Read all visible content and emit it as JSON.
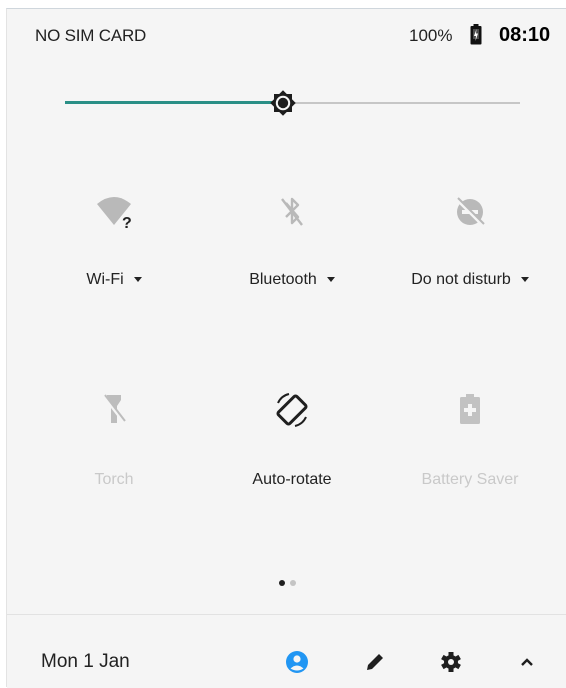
{
  "status": {
    "carrier": "NO SIM CARD",
    "battery_percent": "100%",
    "time": "08:10",
    "icons": [
      "battery-icon"
    ]
  },
  "brightness": {
    "level": 0.48,
    "accent": "#2a8f86"
  },
  "tiles": [
    {
      "id": "wifi",
      "label": "Wi-Fi",
      "icon": "wifi-unknown-icon",
      "expandable": true,
      "enabled": true
    },
    {
      "id": "bluetooth",
      "label": "Bluetooth",
      "icon": "bluetooth-off-icon",
      "expandable": true,
      "enabled": true
    },
    {
      "id": "dnd",
      "label": "Do not disturb",
      "icon": "do-not-disturb-off-icon",
      "expandable": true,
      "enabled": true
    },
    {
      "id": "torch",
      "label": "Torch",
      "icon": "torch-icon",
      "expandable": false,
      "enabled": false
    },
    {
      "id": "rotate",
      "label": "Auto-rotate",
      "icon": "auto-rotate-icon",
      "expandable": false,
      "enabled": true
    },
    {
      "id": "battery_saver",
      "label": "Battery Saver",
      "icon": "battery-saver-icon",
      "expandable": false,
      "enabled": false
    }
  ],
  "pager": {
    "pages": 2,
    "current": 1
  },
  "footer": {
    "date": "Mon 1 Jan",
    "icons": [
      "user-icon",
      "edit-icon",
      "settings-icon",
      "collapse-icon"
    ],
    "user_color": "#2196f3"
  }
}
